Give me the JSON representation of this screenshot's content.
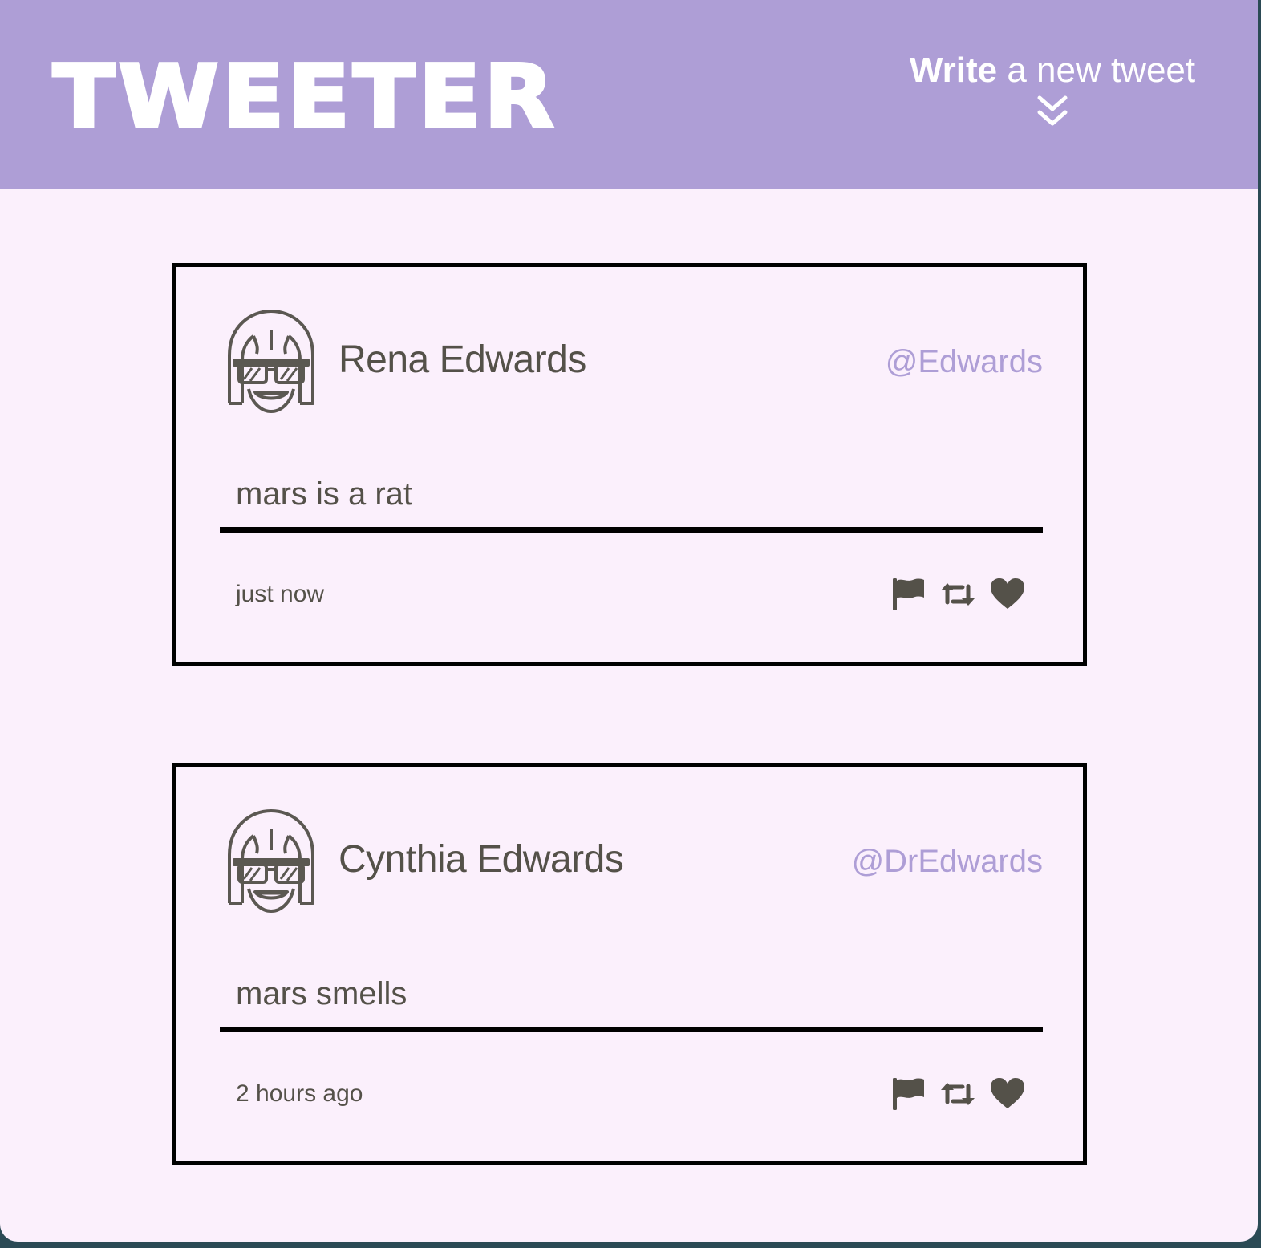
{
  "header": {
    "brand": "TWEETER",
    "compose_bold": "Write",
    "compose_rest": " a new tweet",
    "compose_icon": "double-chevron-down-icon"
  },
  "tweets": [
    {
      "name": "Rena Edwards",
      "handle": "@Edwards",
      "content": "mars is a rat",
      "timestamp": "just now",
      "avatar": "avatar-icon"
    },
    {
      "name": "Cynthia Edwards",
      "handle": "@DrEdwards",
      "content": "mars smells",
      "timestamp": "2 hours ago",
      "avatar": "avatar-icon"
    }
  ],
  "actions": [
    "flag-icon",
    "retweet-icon",
    "heart-icon"
  ],
  "colors": {
    "nav_bg": "#ae9ed6",
    "page_bg": "#fbf0fc",
    "text": "#545149",
    "handle": "#ae9ed6",
    "border": "#000000"
  }
}
